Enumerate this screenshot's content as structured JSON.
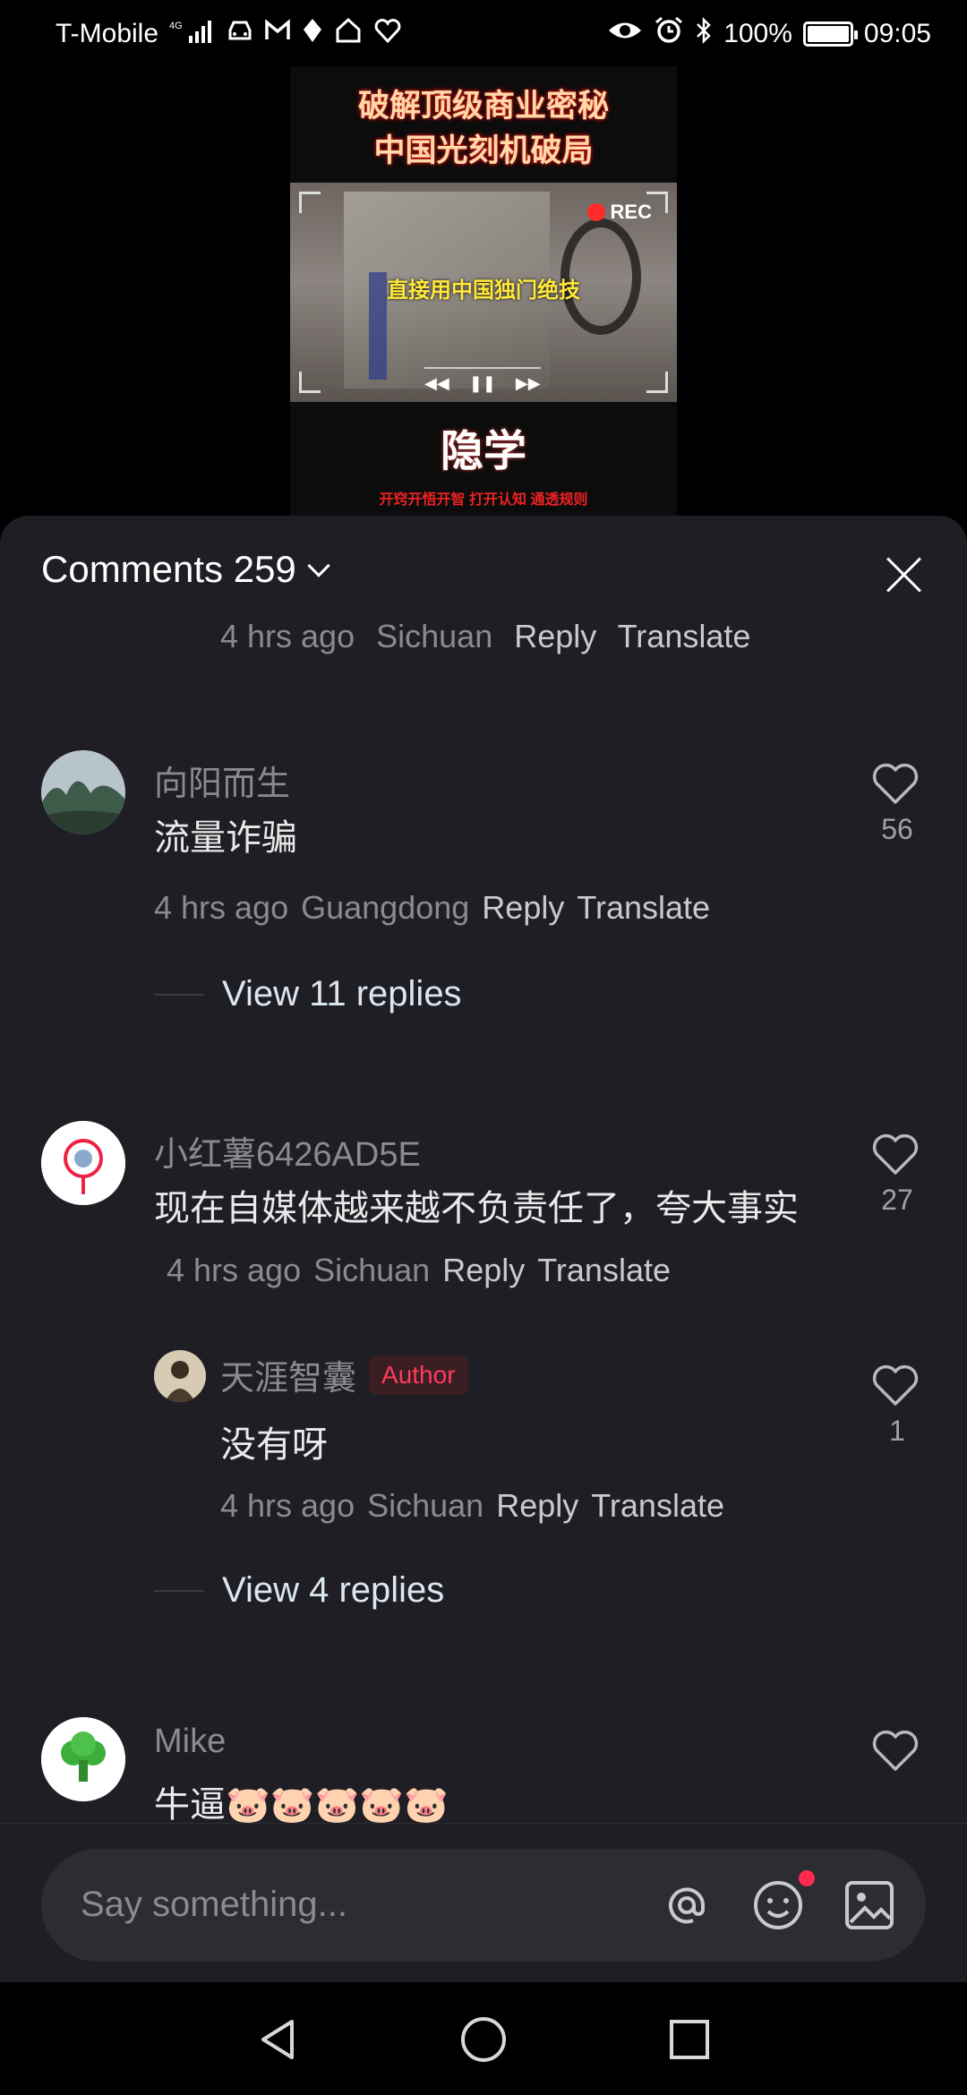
{
  "status": {
    "carrier": "T-Mobile",
    "network": "4G",
    "battery": "100%",
    "time": "09:05",
    "left_icons": [
      "signal-icon",
      "car-icon",
      "gmail-icon",
      "location-icon",
      "home-icon",
      "heart-icon"
    ],
    "right_icons": [
      "eye-icon",
      "alarm-icon",
      "bluetooth-icon",
      "battery-icon"
    ]
  },
  "video": {
    "title_line1": "破解顶级商业密秘",
    "title_line2": "中国光刻机破局",
    "rec_label": "REC",
    "caption": "直接用中国独门绝技",
    "logo": "隐学",
    "slogan": "开窍开悟开智  打开认知  通透规则"
  },
  "comments_header": {
    "title": "Comments 259"
  },
  "partial": {
    "time": "4 hrs ago",
    "location": "Sichuan",
    "reply": "Reply",
    "translate": "Translate"
  },
  "comments": [
    {
      "name": "向阳而生",
      "text": "流量诈骗",
      "time": "4 hrs ago",
      "location": "Guangdong",
      "reply": "Reply",
      "translate": "Translate",
      "likes": "56",
      "view_replies": "View 11 replies"
    },
    {
      "name": "小红薯6426AD5E",
      "text": "现在自媒体越来越不负责任了，夸大事实",
      "time": "4 hrs ago",
      "location": "Sichuan",
      "reply": "Reply",
      "translate": "Translate",
      "likes": "27",
      "sub_reply": {
        "name": "天涯智囊",
        "badge": "Author",
        "text": "没有呀",
        "time": "4 hrs ago",
        "location": "Sichuan",
        "reply": "Reply",
        "translate": "Translate",
        "likes": "1"
      },
      "view_replies": "View 4 replies"
    },
    {
      "name": "Mike",
      "text": "牛逼🐷🐷🐷🐷🐷"
    }
  ],
  "input": {
    "placeholder": "Say something..."
  },
  "colors": {
    "sheet_bg": "#1e1e24",
    "input_bg": "#2c2c33",
    "author_badge": "#ff3b5c",
    "muted_text": "#8a8a93",
    "link_text": "#dce6f0"
  }
}
